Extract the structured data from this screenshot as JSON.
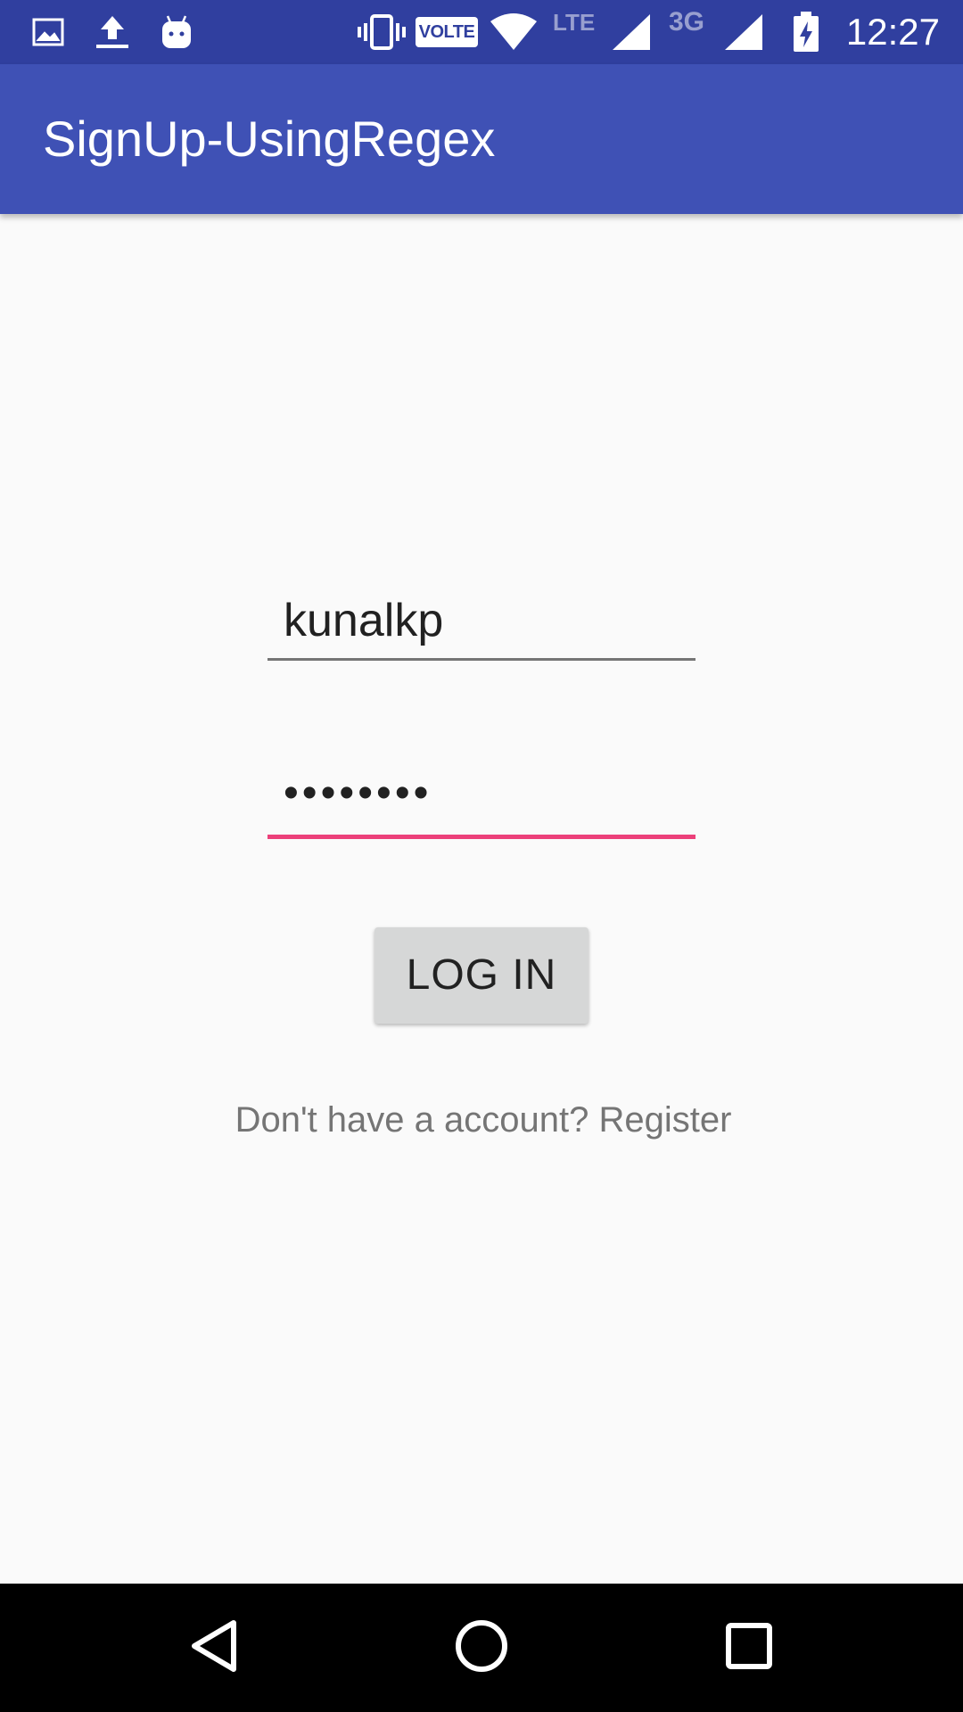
{
  "status_bar": {
    "time": "12:27",
    "volte_label": "VOLTE",
    "lte_label": "LTE",
    "network_3g_label": "3G",
    "icons": [
      "gallery-icon",
      "upload-icon",
      "android-icon",
      "vibrate-icon",
      "wifi-icon",
      "signal-icon",
      "signal-icon",
      "battery-charging-icon"
    ]
  },
  "app_bar": {
    "title": "SignUp-UsingRegex"
  },
  "login_form": {
    "username_value": "kunalkp",
    "password_value": "••••••••",
    "login_button_label": "LOG IN",
    "register_prompt": "Don't have a account? Register"
  },
  "nav_bar": {
    "icons": [
      "back-icon",
      "home-icon",
      "recents-icon"
    ]
  },
  "colors": {
    "status_bar": "#303f9f",
    "app_bar": "#3f51b5",
    "accent": "#ec407a",
    "background": "#fafafa",
    "button": "#d6d7d7"
  }
}
